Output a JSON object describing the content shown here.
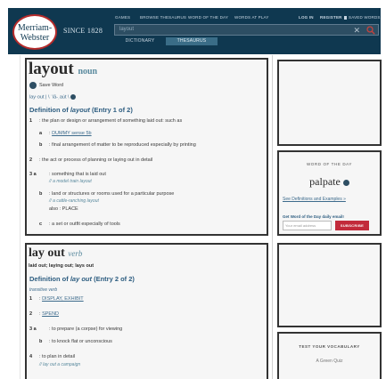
{
  "header": {
    "logo_line1": "Merriam-",
    "logo_line2": "Webster",
    "since": "SINCE 1828",
    "nav": [
      "GAMES",
      "BROWSE THESAURUS",
      "WORD OF THE DAY",
      "WORDS AT PLAY"
    ],
    "login": "LOG IN",
    "register": "REGISTER",
    "saved": "SAVED WORDS",
    "search_value": "layout",
    "search_clear": "✕",
    "tabs": {
      "dictionary": "DICTIONARY",
      "thesaurus": "THESAURUS"
    }
  },
  "entry1": {
    "headword": "layout",
    "pos": "noun",
    "save": "Save Word",
    "pron": "lay·out  |  \\ ˈlā-ˌau̇t  \\",
    "def_head_pre": "Definition of ",
    "def_head_word": "layout",
    "def_head_post": " (Entry 1 of 2)",
    "senses": [
      {
        "num": "1",
        "text": ": the plan or design or arrangement of something laid out: such as"
      },
      {
        "num": "a",
        "text": ": ",
        "link": "DUMMY sense 5b"
      },
      {
        "num": "b",
        "text": ": final arrangement of matter to be reproduced especially by printing"
      },
      {
        "num": "2",
        "text": ": the act or process of planning or laying out in detail"
      },
      {
        "num": "3 a",
        "text": ": something that is laid out"
      },
      {
        "ex": "// a model train layout"
      },
      {
        "num": "b",
        "text": ": land or structures or rooms used for a particular purpose"
      },
      {
        "ex": "// a cattle-ranching layout"
      },
      {
        "text": "also : PLACE"
      },
      {
        "num": "c",
        "text": ": a set or outfit especially of tools"
      }
    ]
  },
  "entry2": {
    "headword": "lay out",
    "pos": "verb",
    "forms": "laid out; laying out; lays out",
    "def_head_pre": "Definition of ",
    "def_head_word": "lay out",
    "def_head_post": " (Entry 2 of 2)",
    "transitive": "transitive verb",
    "senses": [
      {
        "num": "1",
        "text": ": ",
        "link": "DISPLAY, EXHIBIT"
      },
      {
        "num": "2",
        "text": ": ",
        "link": "SPEND"
      },
      {
        "num": "3 a",
        "text": ": to prepare (a corpse) for viewing"
      },
      {
        "num": "b",
        "text": ": to knock flat or unconscious"
      },
      {
        "num": "4",
        "text": ": to plan in detail"
      },
      {
        "ex": "// lay out a campaign"
      }
    ]
  },
  "sidebar": {
    "wotd_label": "WORD OF THE DAY",
    "wotd_word": "palpate",
    "wotd_link": "See Definitions and Examples »",
    "wotd_email_label": "Get Word of the Day daily email!",
    "wotd_placeholder": "Your email address",
    "wotd_button": "SUBSCRIBE",
    "vocab_label": "TEST YOUR VOCABULARY",
    "vocab_sub": "A Green Quiz"
  }
}
